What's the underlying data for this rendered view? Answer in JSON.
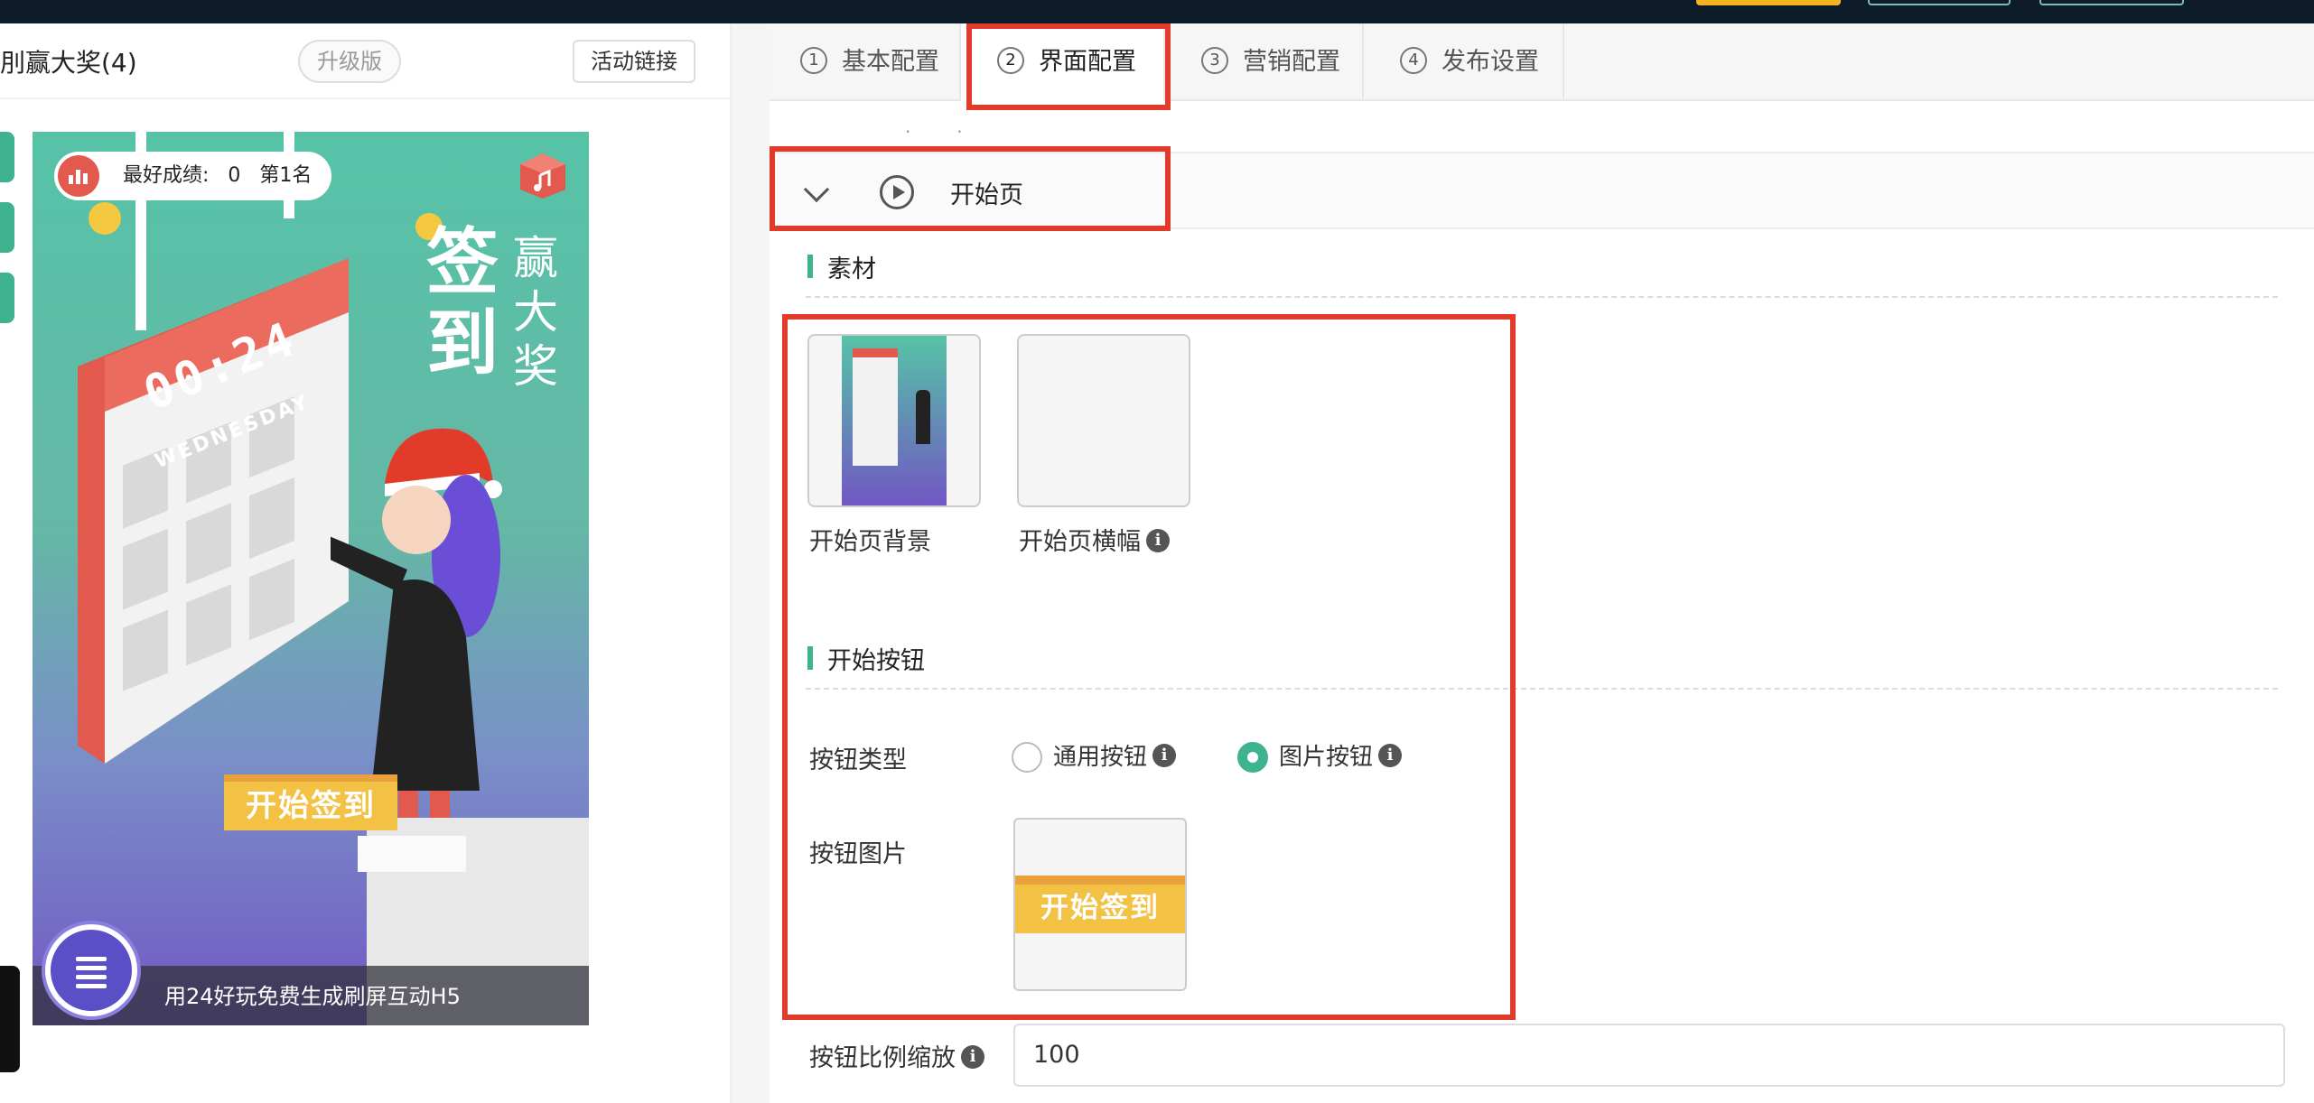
{
  "header": {
    "project_title": "刖赢大奖(4)",
    "upgrade_label": "升级版",
    "activity_link_label": "活动链接"
  },
  "preview": {
    "best_score_label": "最好成绩:",
    "best_score_value": "0",
    "rank_label": "第1名",
    "headline_big": "签到",
    "headline_small": "赢大奖",
    "calendar_time": "00:24",
    "calendar_day": "WEDNESDAY",
    "start_button_label": "开始签到",
    "ad_text": "用24好玩免费生成刷屏互动H5"
  },
  "tabs": [
    {
      "num": "1",
      "label": "基本配置"
    },
    {
      "num": "2",
      "label": "界面配置",
      "active": true
    },
    {
      "num": "3",
      "label": "营销配置"
    },
    {
      "num": "4",
      "label": "发布设置"
    }
  ],
  "section": {
    "title": "开始页",
    "materials_heading": "素材",
    "bg_label": "开始页背景",
    "banner_label": "开始页横幅",
    "start_button_heading": "开始按钮",
    "button_type_label": "按钮类型",
    "button_type_options": [
      "通用按钮",
      "图片按钮"
    ],
    "button_type_selected": "图片按钮",
    "button_image_label": "按钮图片",
    "button_image_text": "开始签到",
    "scale_label": "按钮比例缩放",
    "scale_value": "100"
  },
  "colors": {
    "accent": "#3fb28f",
    "highlight_box": "#e33b2a",
    "button_yellow": "#f3c144"
  }
}
